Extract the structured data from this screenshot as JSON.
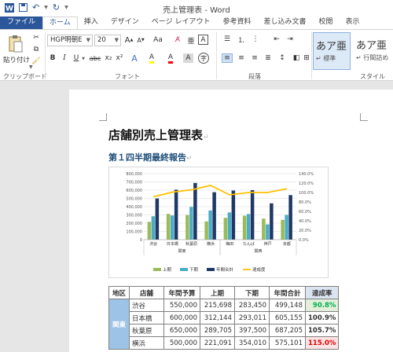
{
  "app": {
    "title": "売上管理表 - Word"
  },
  "tabs": [
    "ファイル",
    "ホーム",
    "挿入",
    "デザイン",
    "ページ レイアウト",
    "参考資料",
    "差し込み文書",
    "校閲",
    "表示"
  ],
  "ribbon": {
    "paste_label": "貼り付け",
    "font_name": "HGP明朝E",
    "font_size": "20",
    "group_clipboard": "クリップボード",
    "group_font": "フォント",
    "group_paragraph": "段落",
    "group_style": "スタイル",
    "style1_sample": "あア亜",
    "style1_name": "↵ 標準",
    "style2_sample": "あア亜",
    "style2_name": "↵ 行間詰め",
    "btn_bold": "B",
    "btn_italic": "I",
    "btn_underline": "U",
    "btn_strike": "abc",
    "btn_sub": "x₂",
    "btn_sup": "x²",
    "btn_grow": "A",
    "btn_case": "Aa",
    "btn_char_border": "A",
    "btn_phonetic": "亜",
    "btn_highlight": "A",
    "btn_font_color": "A",
    "btn_shade": "A",
    "btn_circle": "字"
  },
  "doc": {
    "title": "店舗別売上管理表",
    "subtitle": "第１四半期最終報告",
    "para_mark": "↵"
  },
  "colors": {
    "series1": "#9bbb59",
    "series2": "#4bacc6",
    "series3": "#1f3864",
    "line": "#ffc000",
    "ribbon_blue": "#2b579a"
  },
  "chart_data": {
    "type": "bar",
    "categories": [
      "渋谷",
      "日本橋",
      "秋葉原",
      "横浜",
      "梅田",
      "なんば",
      "神戸",
      "京都"
    ],
    "groups": [
      {
        "name": "関東",
        "from": 0,
        "to": 3
      },
      {
        "name": "関西",
        "from": 4,
        "to": 7
      }
    ],
    "series": [
      {
        "name": "上期",
        "values": [
          215698,
          312144,
          298705,
          221091,
          265000,
          290000,
          255000,
          240000
        ]
      },
      {
        "name": "下期",
        "values": [
          283450,
          293011,
          397500,
          354010,
          330000,
          310000,
          185000,
          300000
        ]
      },
      {
        "name": "年間合計",
        "values": [
          499148,
          605155,
          687205,
          575101,
          595000,
          600000,
          440000,
          540000
        ]
      },
      {
        "name": "達成度",
        "type": "line",
        "axis": "right",
        "values": [
          90.8,
          100.9,
          105.7,
          115.0,
          95.0,
          100.0,
          100.0,
          108.0
        ]
      }
    ],
    "left_axis": {
      "min": 0,
      "max": 800000,
      "ticks": [
        "0",
        "100,000",
        "200,000",
        "300,000",
        "400,000",
        "500,000",
        "600,000",
        "700,000",
        "800,000"
      ]
    },
    "right_axis": {
      "min": 0,
      "max": 140,
      "ticks": [
        "0.0%",
        "20.0%",
        "40.0%",
        "60.0%",
        "80.0%",
        "100.0%",
        "120.0%",
        "140.0%"
      ]
    },
    "legend_position": "bottom",
    "grid": true
  },
  "table": {
    "headers": [
      "地区",
      "店舗",
      "年間予算",
      "上期",
      "下期",
      "年間合計",
      "達成率"
    ],
    "region": "関東",
    "rows": [
      {
        "store": "渋谷",
        "budget": "550,000",
        "h1": "215,698",
        "h2": "283,450",
        "total": "499,148",
        "rate": "90.8%",
        "rate_color": "#00b050",
        "rate_bg": "#e2efda"
      },
      {
        "store": "日本橋",
        "budget": "600,000",
        "h1": "312,144",
        "h2": "293,011",
        "total": "605,155",
        "rate": "100.9%",
        "rate_color": "#333333",
        "rate_bg": "#ffffff"
      },
      {
        "store": "秋葉原",
        "budget": "650,000",
        "h1": "289,705",
        "h2": "397,500",
        "total": "687,205",
        "rate": "105.7%",
        "rate_color": "#333333",
        "rate_bg": "#ffffff"
      },
      {
        "store": "横浜",
        "budget": "500,000",
        "h1": "221,091",
        "h2": "354,010",
        "total": "575,101",
        "rate": "115.0%",
        "rate_color": "#e00000",
        "rate_bg": "#fce4e4"
      }
    ]
  }
}
